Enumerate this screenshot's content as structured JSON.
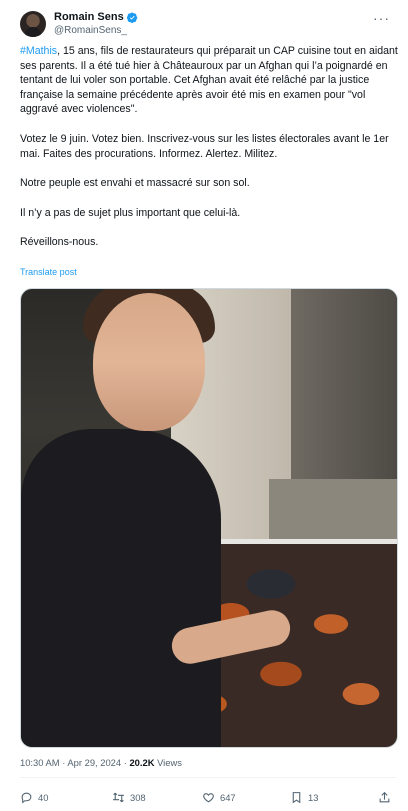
{
  "author": {
    "display_name": "Romain Sens",
    "handle": "@RomainSens_"
  },
  "tweet": {
    "hashtag": "#Mathis",
    "para1_rest": ", 15 ans, fils de restaurateurs qui préparait un CAP cuisine tout en aidant ses parents. Il a été tué hier à Châteauroux par un Afghan qui l’a poignardé en tentant de lui voler son portable. Cet Afghan avait été relâché par la justice française la semaine précédente après avoir été mis en examen pour \"vol aggravé avec violences\".",
    "para2": "Votez le 9 juin. Votez bien. Inscrivez-vous sur les listes électorales avant le 1er mai. Faites des procurations. Informez. Alertez. Militez.",
    "para3": "Notre peuple est envahi et massacré sur son sol.",
    "para4": "Il n’y a pas de sujet plus important que celui-là.",
    "para5": "Réveillons-nous.",
    "translate_label": "Translate post"
  },
  "meta": {
    "timestamp": "10:30 AM · Apr 29, 2024",
    "separator": " · ",
    "views_count": "20.2K",
    "views_label": " Views"
  },
  "actions": {
    "replies": "40",
    "reposts": "308",
    "likes": "647",
    "bookmarks": "13"
  },
  "colors": {
    "accent": "#1d9bf0",
    "muted": "#536471"
  }
}
